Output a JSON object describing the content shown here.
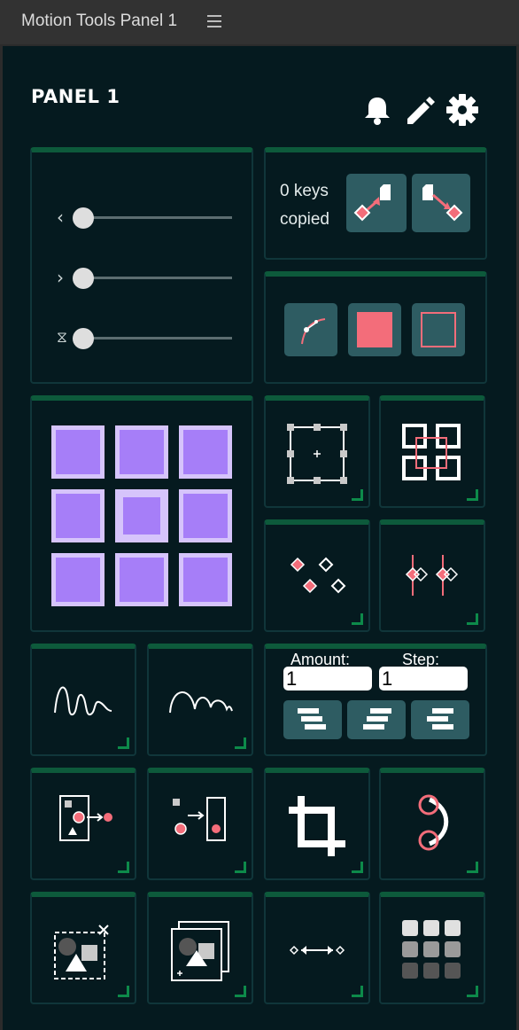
{
  "window": {
    "tab_title": "Motion Tools Panel 1",
    "menu_icon": "hamburger-icon"
  },
  "panel": {
    "title": "PANEL 1"
  },
  "header_icons": [
    "bell-icon",
    "pencil-icon",
    "gear-icon"
  ],
  "sliders": [
    {
      "icon": "chevron-left-icon",
      "symbol": "‹",
      "value": 0
    },
    {
      "icon": "chevron-right-icon",
      "symbol": "›",
      "value": 0
    },
    {
      "icon": "hourglass-icon",
      "symbol": "⧖",
      "value": 0
    }
  ],
  "keys": {
    "count": "0 keys",
    "status": "copied"
  },
  "offset": {
    "amount_label": "Amount:",
    "amount_value": "1",
    "step_label": "Step:",
    "step_value": "1"
  },
  "colors": {
    "accent": "#0d5a3b",
    "panel_bg": "#051a1f",
    "pink": "#f36d7a",
    "purple": "#a67ef8",
    "button": "#2e5c62"
  }
}
